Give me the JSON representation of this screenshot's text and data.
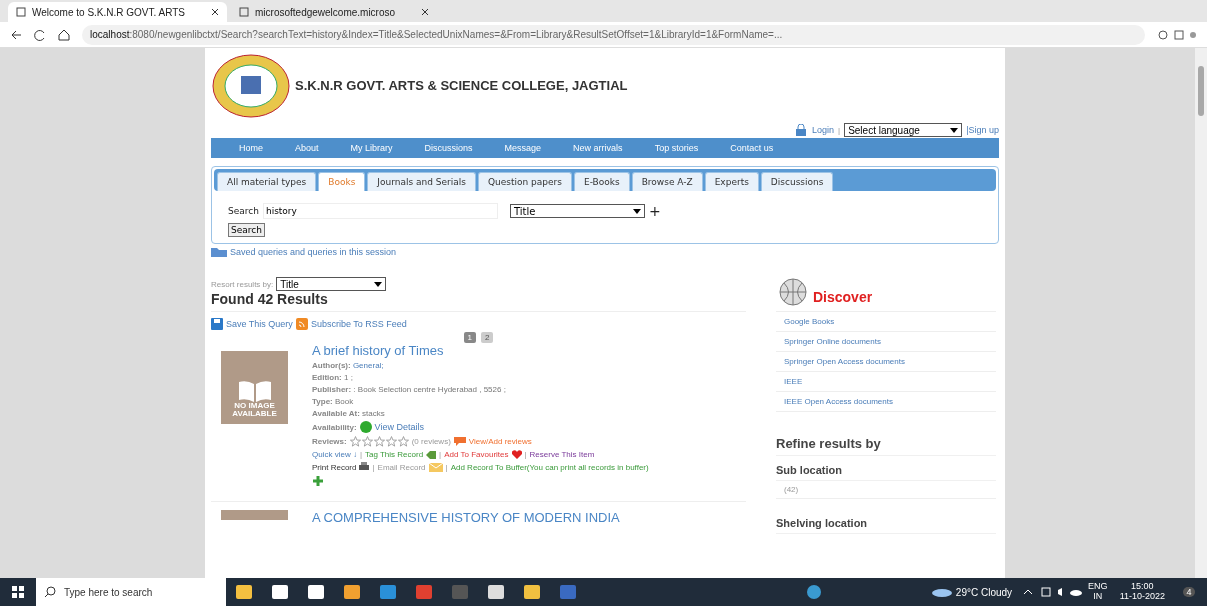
{
  "browser": {
    "tabs": [
      {
        "title": "Welcome to S.K.N.R GOVT. ARTS",
        "selected": true
      },
      {
        "title": "microsoftedgewelcome.microso",
        "selected": false
      }
    ],
    "url_host": "localhost",
    "url_rest": ":8080/newgenlibctxt/Search?searchText=history&Index=Title&SelectedUnixNames=&From=Library&ResultSetOffset=1&LibraryId=1&FormName=..."
  },
  "header": {
    "college_name": "S.K.N.R GOVT. ARTS & SCIENCE COLLEGE, JAGTIAL",
    "login": "Login",
    "separator": "|",
    "language_select": "Select language",
    "signup": "|Sign up"
  },
  "nav": [
    "Home",
    "About",
    "My Library",
    "Discussions",
    "Message",
    "New arrivals",
    "Top stories",
    "Contact us"
  ],
  "material_tabs": [
    {
      "label": "All material types",
      "selected": false
    },
    {
      "label": "Books",
      "selected": true
    },
    {
      "label": "Journals and Serials",
      "selected": false
    },
    {
      "label": "Question papers",
      "selected": false
    },
    {
      "label": "E-Books",
      "selected": false
    },
    {
      "label": "Browse A-Z",
      "selected": false
    },
    {
      "label": "Experts",
      "selected": false
    },
    {
      "label": "Discussions",
      "selected": false
    }
  ],
  "search": {
    "label": "Search",
    "value": "history",
    "index_select": "Title",
    "add": "+",
    "button": "Search"
  },
  "saved_queries": "Saved queries and queries in this session",
  "results": {
    "resort_label": "Resort results by:",
    "resort_value": "Title",
    "found": "Found 42 Results",
    "save_query": "Save This Query",
    "rss": "Subscribe To RSS Feed",
    "pages": [
      {
        "label": "1",
        "selected": true
      },
      {
        "label": "2",
        "selected": false
      }
    ]
  },
  "records": [
    {
      "title": "A brief history of Times",
      "cover_text": "NO IMAGE AVAILABLE",
      "fields": [
        {
          "label": "Author(s):",
          "value": "General;",
          "link": true
        },
        {
          "label": "Edition:",
          "value": "1 ;",
          "link": false
        },
        {
          "label": "Publisher:",
          "value": ": Book Selection centre Hyderabad , 5526 ;",
          "link": false
        },
        {
          "label": "Type:",
          "value": "Book",
          "link": false
        },
        {
          "label": "Available At:",
          "value": "stacks",
          "link": false
        }
      ],
      "availability_label": "Availability:",
      "view_details": "View Details",
      "reviews_label": "Reviews:",
      "stars": 0,
      "review_count": "(0 reviews)",
      "view_add_reviews": "View/Add reviews",
      "quick_view": "Quick view ↓",
      "tag": "Tag This Record",
      "favourites": "Add To Favourites",
      "reserve": "Reserve This Item",
      "print": "Print Record",
      "email": "Email Record",
      "buffer": "Add Record To Buffer(You can print all records in buffer)",
      "separator": "|"
    },
    {
      "title": "A COMPREHENSIVE HISTORY OF MODERN INDIA"
    }
  ],
  "discover": {
    "title": "Discover",
    "links": [
      "Google Books",
      "Springer Online documents",
      "Springer Open Access documents",
      "IEEE",
      "IEEE Open Access documents"
    ]
  },
  "refine": {
    "title": "Refine results by",
    "sections": [
      {
        "title": "Sub location",
        "items": [
          "(42)"
        ]
      },
      {
        "title": "Shelving location"
      }
    ]
  },
  "taskbar": {
    "search_placeholder": "Type here to search",
    "weather": "29°C Cloudy",
    "lang": "ENG",
    "region": "IN",
    "time": "15:00",
    "date": "11-10-2022",
    "notifications": "4"
  }
}
